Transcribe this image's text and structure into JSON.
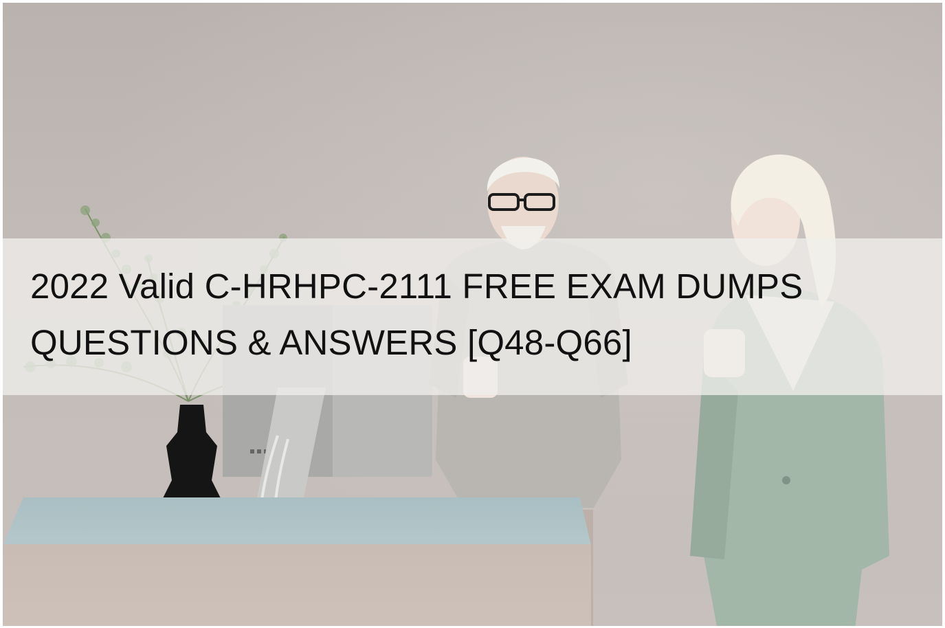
{
  "title": {
    "line1": "2022 Valid C-HRHPC-2111 FREE EXAM DUMPS",
    "line2": "QUESTIONS & ANSWERS [Q48-Q66]"
  },
  "colors": {
    "wall": "#c1bab6",
    "banner_overlay": "#f0eeec",
    "title_text": "#111111",
    "desk_top": "#b0c4c7",
    "vase": "#151515",
    "suit": "#9fb3a6"
  }
}
